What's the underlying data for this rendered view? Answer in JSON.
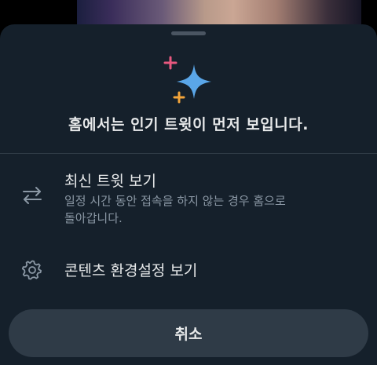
{
  "sheet": {
    "headline": "홈에서는 인기 트윗이 먼저 보입니다.",
    "icon": "sparkle-icon"
  },
  "options": [
    {
      "icon": "swap-arrows-icon",
      "title": "최신 트윗 보기",
      "description": "일정 시간 동안 접속을 하지 않는 경우 홈으로 돌아갑니다."
    },
    {
      "icon": "gear-icon",
      "title": "콘텐츠 환경설정 보기"
    }
  ],
  "cancel_label": "취소",
  "colors": {
    "sheet_background": "#15202b",
    "primary_text": "#e7e9ea",
    "secondary_text": "#8b98a5",
    "sparkle_blue": "#1d9bf0",
    "sparkle_pink": "#f91880",
    "sparkle_orange": "#ffad1f"
  }
}
